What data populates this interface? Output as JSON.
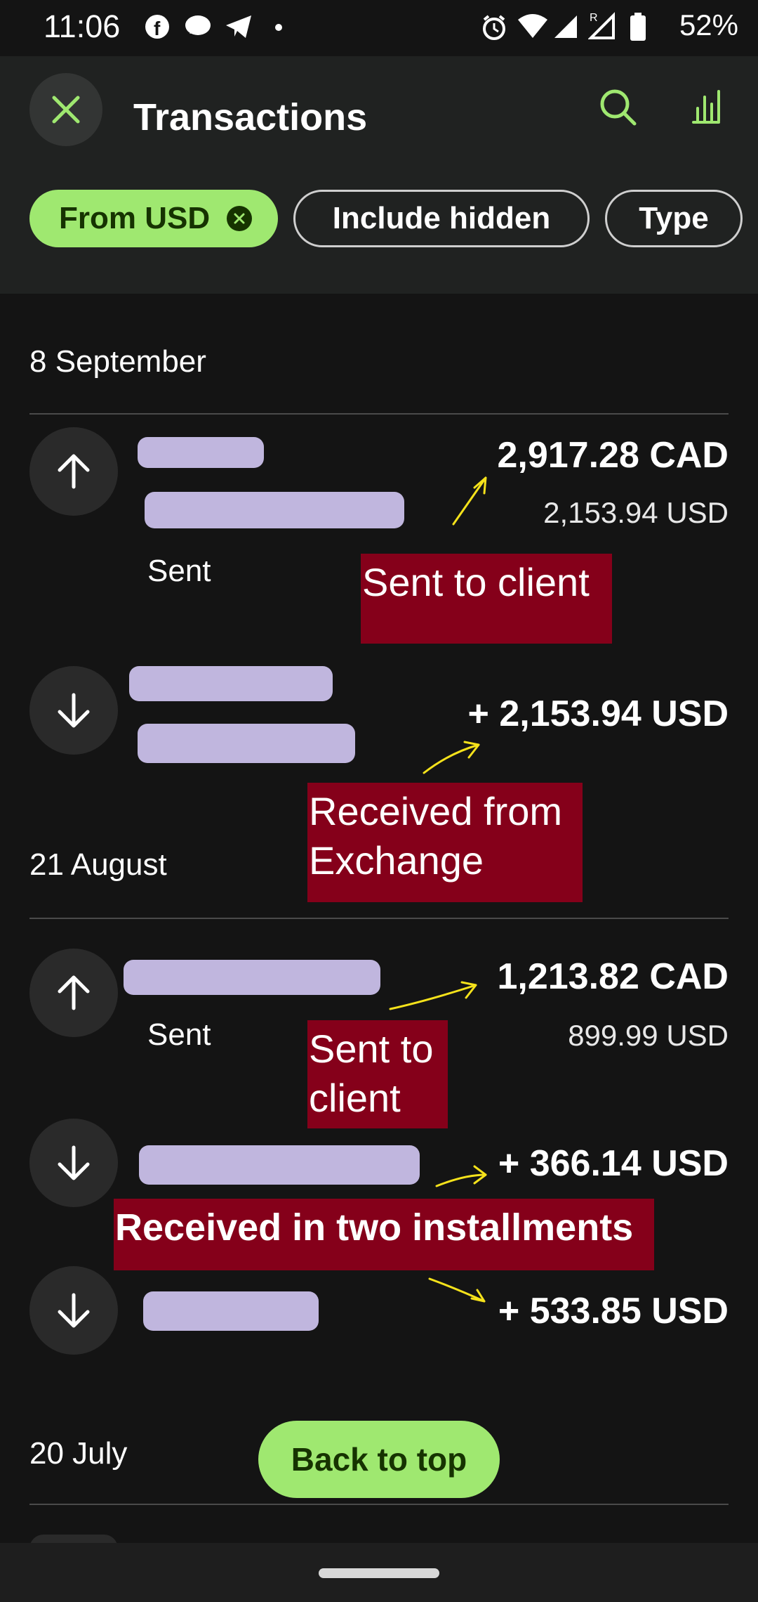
{
  "status_bar": {
    "time": "11:06",
    "left_icons": [
      "facebook-icon",
      "messenger-icon",
      "telegram-icon",
      "dot-icon"
    ],
    "right_icons": [
      "alarm-icon",
      "wifi-icon",
      "signal-icon",
      "signal-roaming-icon",
      "battery-icon"
    ],
    "battery": "52%"
  },
  "header": {
    "title": "Transactions",
    "filters": [
      {
        "label": "From USD",
        "active": true
      },
      {
        "label": "Include hidden",
        "active": false
      },
      {
        "label": "Type",
        "active": false
      }
    ]
  },
  "groups": [
    {
      "date": "8 September",
      "transactions": [
        {
          "direction": "sent",
          "status": "Sent",
          "amount": "2,917.28 CAD",
          "sub_amount": "2,153.94 USD",
          "annotation": "Sent to client"
        },
        {
          "direction": "received",
          "status": "",
          "amount": "+ 2,153.94 USD",
          "sub_amount": "",
          "annotation": "Received from Exchange"
        }
      ]
    },
    {
      "date": "21 August",
      "transactions": [
        {
          "direction": "sent",
          "status": "Sent",
          "amount": "1,213.82 CAD",
          "sub_amount": "899.99 USD",
          "annotation": "Sent to client"
        },
        {
          "direction": "received",
          "status": "",
          "amount": "+ 366.14 USD",
          "sub_amount": ""
        },
        {
          "direction": "received",
          "status": "",
          "amount": "+ 533.85 USD",
          "sub_amount": ""
        }
      ],
      "group_annotation": "Received in two installments"
    },
    {
      "date": "20 July",
      "transactions": []
    }
  ],
  "back_to_top_label": "Back to top",
  "colors": {
    "accent_green": "#9fe870",
    "dark_green": "#163300",
    "annotation_red": "#85001a",
    "annotation_arrow": "#f5e21b",
    "redaction": "#c9bfe9"
  }
}
